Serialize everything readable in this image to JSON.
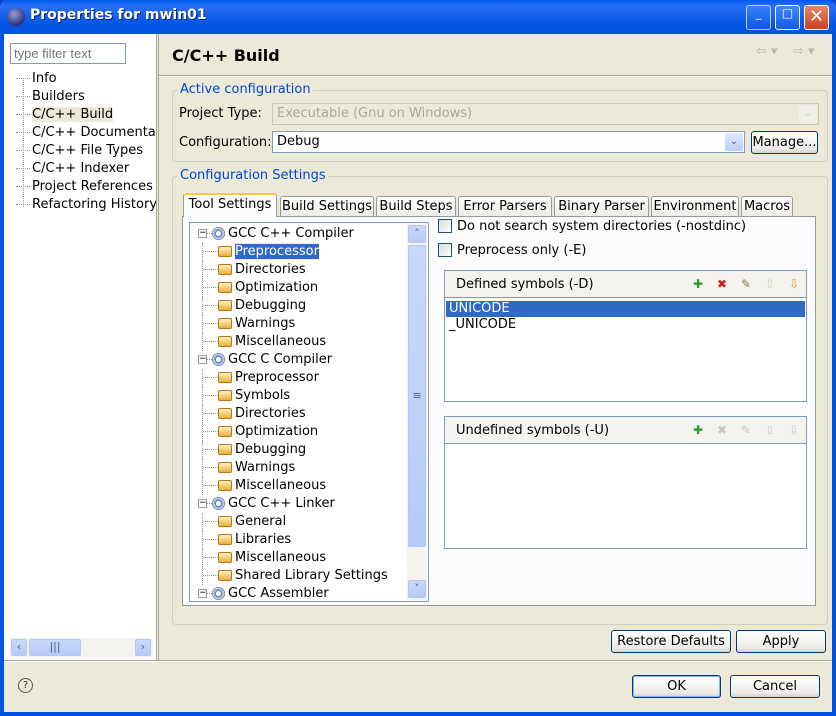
{
  "window": {
    "title": "Properties for mwin01",
    "controls": [
      "minimize",
      "maximize",
      "close"
    ]
  },
  "filter": {
    "placeholder": "type filter text"
  },
  "nav": {
    "items": [
      "Info",
      "Builders",
      "C/C++ Build",
      "C/C++ Documentation",
      "C/C++ File Types",
      "C/C++ Indexer",
      "Project References",
      "Refactoring History"
    ],
    "selected": "C/C++ Build"
  },
  "header": {
    "title": "C/C++ Build"
  },
  "active_config": {
    "title": "Active configuration",
    "project_type_label": "Project Type:",
    "project_type_value": "Executable (Gnu on Windows)",
    "configuration_label": "Configuration:",
    "configuration_value": "Debug",
    "manage_label": "Manage..."
  },
  "config_settings": {
    "title": "Configuration Settings",
    "tabs": [
      "Tool Settings",
      "Build Settings",
      "Build Steps",
      "Error Parsers",
      "Binary Parser",
      "Environment",
      "Macros"
    ],
    "active_tab": "Tool Settings",
    "tree": [
      {
        "label": "GCC C++ Compiler",
        "children": [
          "Preprocessor",
          "Directories",
          "Optimization",
          "Debugging",
          "Warnings",
          "Miscellaneous"
        ]
      },
      {
        "label": "GCC C Compiler",
        "children": [
          "Preprocessor",
          "Symbols",
          "Directories",
          "Optimization",
          "Debugging",
          "Warnings",
          "Miscellaneous"
        ]
      },
      {
        "label": "GCC C++ Linker",
        "children": [
          "General",
          "Libraries",
          "Miscellaneous",
          "Shared Library Settings"
        ]
      },
      {
        "label": "GCC Assembler",
        "children": []
      }
    ],
    "tree_selected": "Preprocessor",
    "options": {
      "nostdinc_label": "Do not search system directories (-nostdinc)",
      "nostdinc_checked": false,
      "preprocess_only_label": "Preprocess only (-E)",
      "preprocess_only_checked": false
    },
    "defined": {
      "title": "Defined symbols (-D)",
      "items": [
        "UNICODE",
        "_UNICODE"
      ],
      "selected": "UNICODE"
    },
    "undefined": {
      "title": "Undefined symbols (-U)",
      "items": []
    }
  },
  "buttons": {
    "restore_defaults": "Restore Defaults",
    "apply": "Apply",
    "ok": "OK",
    "cancel": "Cancel"
  },
  "colors": {
    "accent": "#0046d5",
    "selection": "#316ac5",
    "titlebar": "#0054e3"
  }
}
